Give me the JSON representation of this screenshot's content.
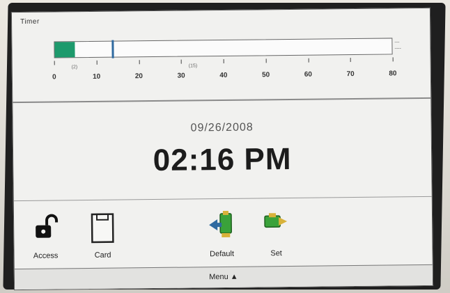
{
  "screen": {
    "small_title": "Timer",
    "progress": {
      "fill_fraction": 0.06,
      "marker_fraction": 0.17,
      "end_label_top": "---",
      "end_label_bottom": "----",
      "ticks": [
        "0",
        "10",
        "20",
        "30",
        "40",
        "50",
        "60",
        "70",
        "80"
      ],
      "mini_labels": [
        "(2)",
        "(15)"
      ]
    },
    "date": "09/26/2008",
    "time": "02:16 PM",
    "toolbar": {
      "access_label": "Access",
      "card_label": "Card",
      "default_label": "Default",
      "set_label": "Set"
    },
    "menu_label": "Menu"
  },
  "colors": {
    "fill": "#1d9a6c",
    "marker": "#2f6aa0",
    "icon_green": "#3aa23a",
    "icon_yellow": "#d8b23a"
  }
}
